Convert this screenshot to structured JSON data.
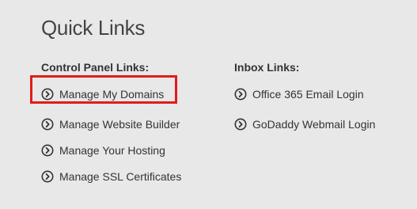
{
  "page": {
    "title": "Quick Links"
  },
  "control_panel": {
    "heading": "Control Panel Links:",
    "links": [
      {
        "label": "Manage My Domains",
        "icon": "chevron-circle-right-icon"
      },
      {
        "label": "Manage Website Builder",
        "icon": "chevron-circle-right-icon"
      },
      {
        "label": "Manage Your Hosting",
        "icon": "chevron-circle-right-icon"
      },
      {
        "label": "Manage SSL Certificates",
        "icon": "chevron-circle-right-icon"
      }
    ]
  },
  "inbox": {
    "heading": "Inbox Links:",
    "links": [
      {
        "label": "Office 365 Email Login",
        "icon": "chevron-circle-right-icon"
      },
      {
        "label": "GoDaddy Webmail Login",
        "icon": "chevron-circle-right-icon"
      }
    ]
  },
  "colors": {
    "background": "#e8e8e8",
    "text": "#333333",
    "highlight": "#e21b1b"
  }
}
